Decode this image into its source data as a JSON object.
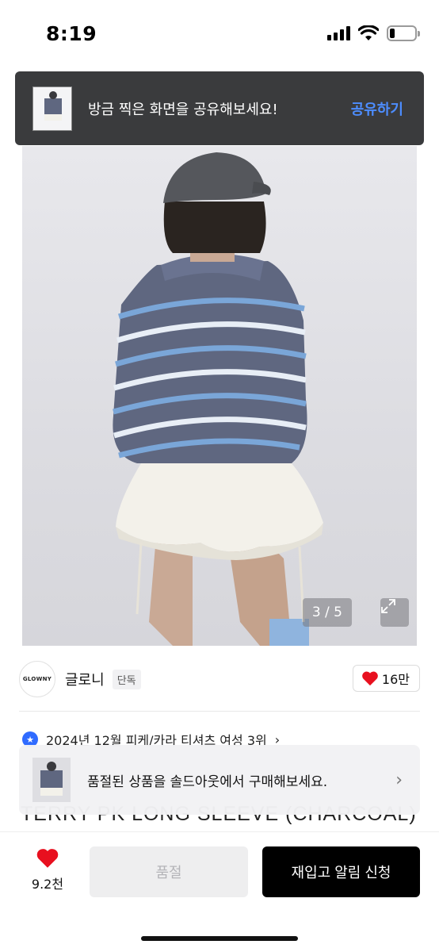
{
  "status_bar": {
    "time": "8:19",
    "battery_level": 0.2
  },
  "share_toast": {
    "message": "방금 찍은 화면을 공유해보세요!",
    "action_label": "공유하기"
  },
  "gallery": {
    "counter": "3 / 5"
  },
  "brand": {
    "logo_text": "GLOWNY",
    "name": "글로니",
    "badge": "단독",
    "like_count": "16만"
  },
  "ranking": {
    "text": "2024년 12월 피케/카라 티셔츠 여성 3위",
    "chevron": "›"
  },
  "product": {
    "title_partial": "TERRY PK LONG SLEEVE (CHARCOAL)"
  },
  "soldout_banner": {
    "message": "품절된 상품을 솔드아웃에서 구매해보세요.",
    "chevron": "›"
  },
  "bottom_bar": {
    "like_count": "9.2천",
    "soldout_label": "품절",
    "restock_label": "재입고 알림 신청"
  },
  "colors": {
    "accent_blue": "#4d8dff",
    "heart_red": "#e8101f",
    "primary_button": "#000000",
    "toast_bg": "#3a3b3d"
  },
  "icons": [
    "signal-icon",
    "wifi-icon",
    "battery-icon",
    "expand-icon",
    "heart-icon",
    "ranking-badge-icon",
    "chevron-right-icon"
  ]
}
